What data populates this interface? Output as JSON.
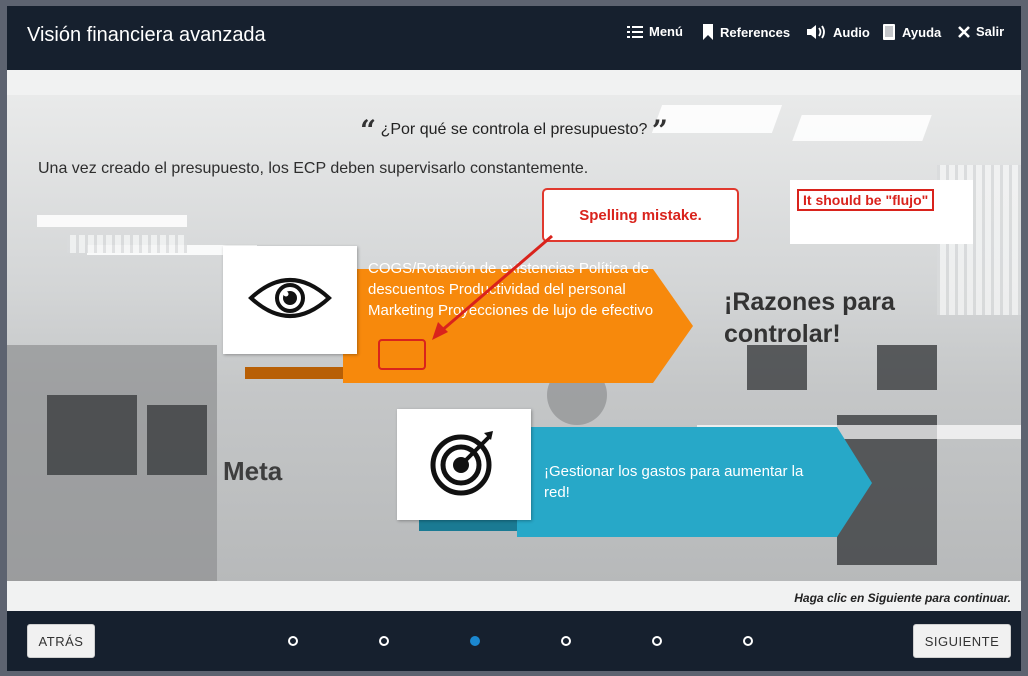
{
  "header": {
    "title": "Visión financiera avanzada",
    "menu_label": "Menú",
    "references_label": "References",
    "audio_label": "Audio",
    "help_label": "Ayuda",
    "exit_label": "Salir"
  },
  "slide": {
    "question": "¿Por qué se controla el presupuesto?",
    "intro": "Una vez creado el presupuesto, los ECP deben supervisarlo constantemente.",
    "banner_orange_text": "COGS/Rotación de existencias Política de descuentos Productividad del personal Marketing Proyecciones de lujo de efectivo",
    "banner_blue_text": "¡Gestionar los gastos para aumentar la red!",
    "reasons_title": "¡Razones para controlar!",
    "goal_label": "Meta",
    "continue_hint": "Haga clic en Siguiente para continuar."
  },
  "annotations": {
    "spelling_note": "Spelling mistake.",
    "correction_note": "It should be \"flujo\""
  },
  "footer": {
    "back_label": "ATRÁS",
    "next_label": "SIGUIENTE",
    "progress": {
      "total": 6,
      "current": 3
    }
  },
  "colors": {
    "header_bg": "#16202e",
    "orange": "#f7890c",
    "blue": "#27a8c8",
    "annotation_red": "#d9231c",
    "active_dot": "#1b87cf"
  },
  "icons": [
    "list-icon",
    "bookmark-icon",
    "speaker-icon",
    "book-icon",
    "close-icon",
    "eye-icon",
    "target-icon"
  ]
}
